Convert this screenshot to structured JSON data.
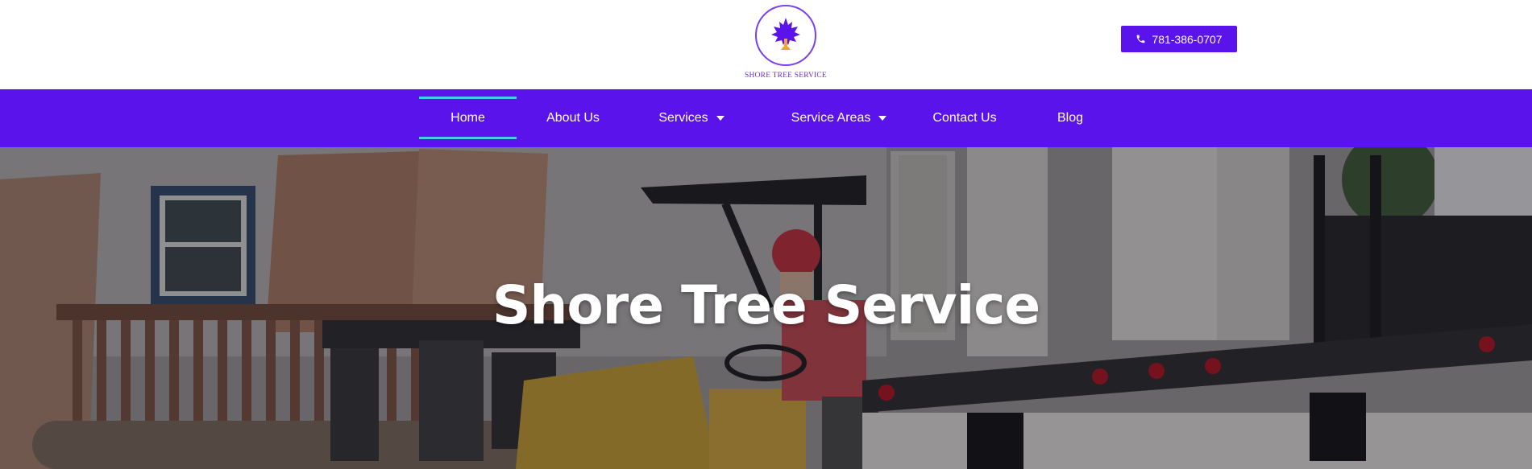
{
  "header": {
    "logo_text": "SHORE TREE SERVICE",
    "phone_label": "781-386-0707",
    "phone_icon": "phone-icon"
  },
  "nav": {
    "items": [
      {
        "label": "Home",
        "active": true,
        "has_dropdown": false
      },
      {
        "label": "About Us",
        "active": false,
        "has_dropdown": false
      },
      {
        "label": "Services",
        "active": false,
        "has_dropdown": true
      },
      {
        "label": "Service Areas",
        "active": false,
        "has_dropdown": true
      },
      {
        "label": "Contact Us",
        "active": false,
        "has_dropdown": false
      },
      {
        "label": "Blog",
        "active": false,
        "has_dropdown": false
      }
    ]
  },
  "hero": {
    "title": "Shore Tree Service"
  },
  "colors": {
    "brand": "#5b13ec",
    "active_underline": "#3fd1e6",
    "logo_accent": "#7a3ff0"
  }
}
